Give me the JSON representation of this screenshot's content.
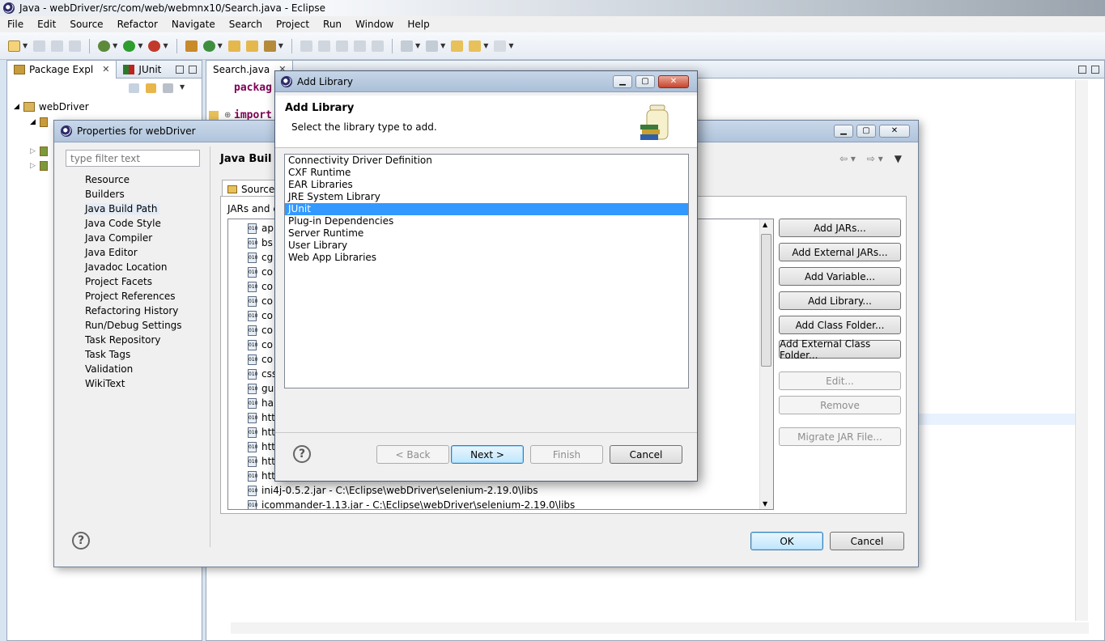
{
  "window": {
    "title": "Java - webDriver/src/com/web/webmnx10/Search.java - Eclipse"
  },
  "menu": [
    "File",
    "Edit",
    "Source",
    "Refactor",
    "Navigate",
    "Search",
    "Project",
    "Run",
    "Window",
    "Help"
  ],
  "left_panel": {
    "tabs": [
      {
        "label": "Package Expl"
      },
      {
        "label": "JUnit"
      }
    ],
    "tree_root": "webDriver"
  },
  "editor": {
    "tab_label": "Search.java",
    "code_lines": [
      "packag",
      "import"
    ]
  },
  "properties_dialog": {
    "title": "Properties for webDriver",
    "filter_placeholder": "type filter text",
    "nav_items": [
      "Resource",
      "Builders",
      "Java Build Path",
      "Java Code Style",
      "Java Compiler",
      "Java Editor",
      "Javadoc Location",
      "Project Facets",
      "Project References",
      "Refactoring History",
      "Run/Debug Settings",
      "Task Repository",
      "Task Tags",
      "Validation",
      "WikiText"
    ],
    "selected_nav": "Java Build Path",
    "section_title": "Java Buil",
    "source_tab": "Source",
    "jars_label": "JARs and cl",
    "jar_rows": [
      "ap",
      "bs",
      "cg",
      "co",
      "co",
      "co",
      "co",
      "co",
      "co",
      "co",
      "css",
      "gu",
      "ha",
      "htt",
      "htt",
      "htt",
      "htt",
      "htt",
      "ini4j-0.5.2.jar - C:\\Eclipse\\webDriver\\selenium-2.19.0\\libs",
      "icommander-1.13.jar - C:\\Eclipse\\webDriver\\selenium-2.19.0\\libs"
    ],
    "side_buttons": {
      "add_jars": "Add JARs...",
      "add_external_jars": "Add External JARs...",
      "add_variable": "Add Variable...",
      "add_library": "Add Library...",
      "add_class_folder": "Add Class Folder...",
      "add_external_class_folder": "Add External Class Folder...",
      "edit": "Edit...",
      "remove": "Remove",
      "migrate": "Migrate JAR File..."
    },
    "ok": "OK",
    "cancel": "Cancel"
  },
  "wizard": {
    "title": "Add Library",
    "heading": "Add Library",
    "description": "Select the library type to add.",
    "library_types": [
      "Connectivity Driver Definition",
      "CXF Runtime",
      "EAR Libraries",
      "JRE System Library",
      "JUnit",
      "Plug-in Dependencies",
      "Server Runtime",
      "User Library",
      "Web App Libraries"
    ],
    "selected_library": "JUnit",
    "back": "< Back",
    "next": "Next >",
    "finish": "Finish",
    "cancel": "Cancel"
  },
  "colors": {
    "selection": "#3399ff",
    "title_bar": "#b0c4dc"
  }
}
